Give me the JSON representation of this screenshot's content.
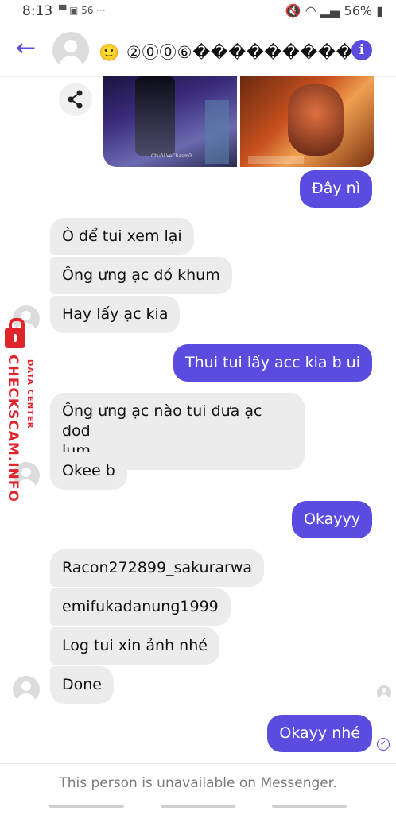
{
  "status_bar": {
    "time": "8:13",
    "notification_icons": "▀ ▣ 56 ···",
    "battery": "56%"
  },
  "header": {
    "contact_name": "🙂 ②⓪⓪⑥���������",
    "back_icon": "arrow-left-icon",
    "info_icon": "info-icon",
    "info_glyph": "i",
    "accent_color": "#5b4ce0"
  },
  "media": {
    "image1_caption": "Chuỗi VeChasmữ"
  },
  "messages": [
    {
      "side": "out",
      "text": "Đây nì"
    },
    {
      "side": "in",
      "text": "Ò để tui xem lại"
    },
    {
      "side": "in",
      "text": "Ông ưng ạc đó khum"
    },
    {
      "side": "in",
      "text": "Hay lấy ạc kia"
    },
    {
      "side": "out",
      "text": "Thui tui lấy acc kia b ui"
    },
    {
      "side": "in",
      "text": "Ông ưng ạc nào tui đưa ạc dod lum"
    },
    {
      "side": "in",
      "text": "Okee b"
    },
    {
      "side": "out",
      "text": "Okayyy"
    },
    {
      "side": "in",
      "text": "Racon272899_sakurarwa"
    },
    {
      "side": "in",
      "text": "emifukadanung1999"
    },
    {
      "side": "in",
      "text": "Log tui xin ảnh nhé"
    },
    {
      "side": "in",
      "text": "Done"
    },
    {
      "side": "out",
      "text": "Okayy nhé"
    }
  ],
  "msg_line2": "lum",
  "msg_line1": "Ông ưng ạc nào tui đưa ạc dod",
  "watermark": {
    "brand": "CHECKSCAM.INFO",
    "sub": "DATA CENTER"
  },
  "footer": {
    "notice": "This person is unavailable on Messenger."
  }
}
